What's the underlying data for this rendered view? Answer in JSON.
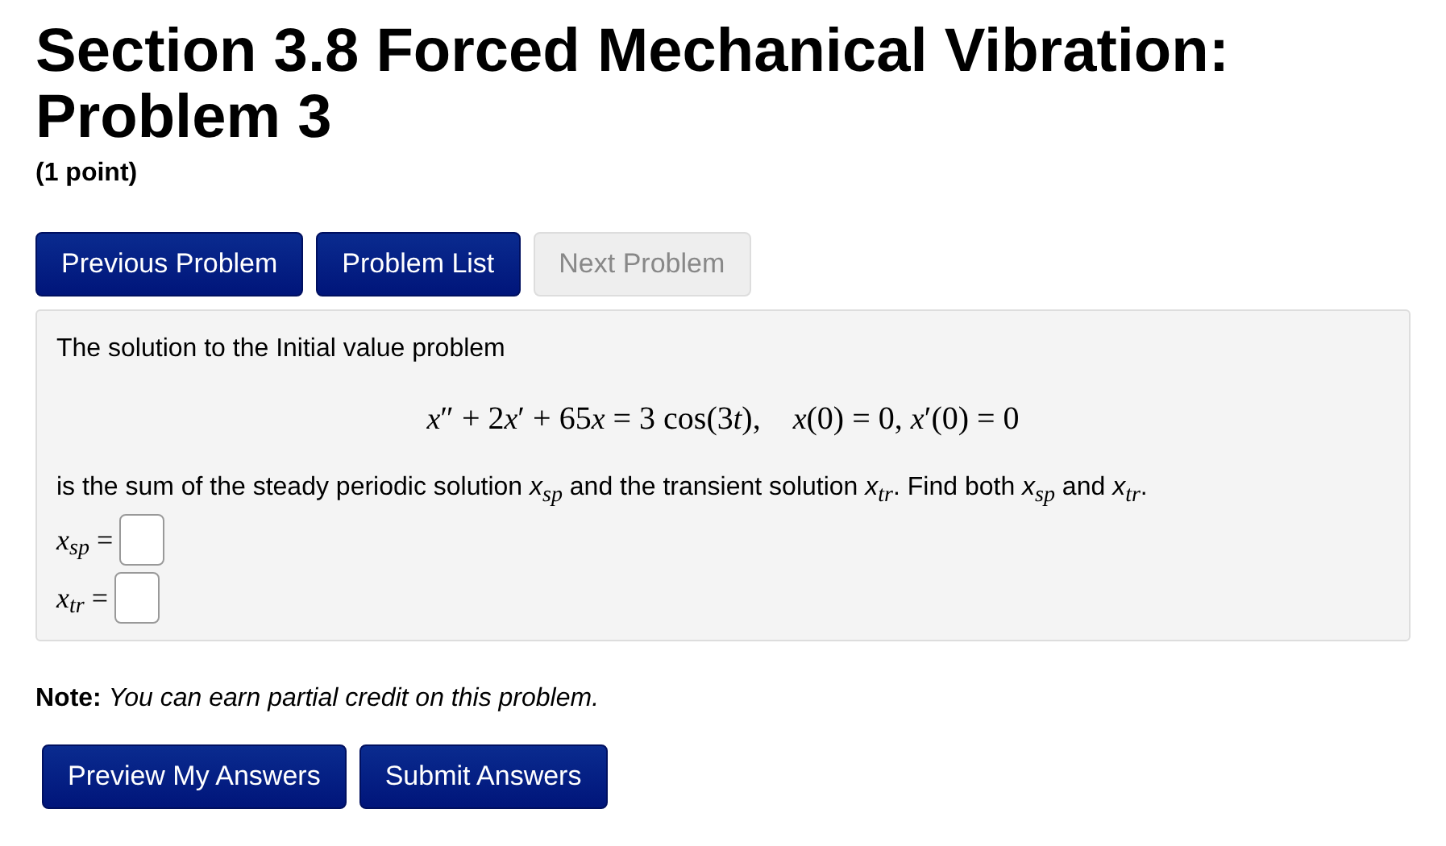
{
  "title": "Section 3.8 Forced Mechanical Vibration: Problem 3",
  "points": "(1 point)",
  "nav_buttons": [
    {
      "label": "Previous Problem",
      "disabled": false
    },
    {
      "label": "Problem List",
      "disabled": false
    },
    {
      "label": "Next Problem",
      "disabled": true
    }
  ],
  "problem": {
    "intro": "The solution to the Initial value problem",
    "equation": [
      {
        "text": "x",
        "italic": true
      },
      {
        "text": "″ + 2",
        "italic": false
      },
      {
        "text": "x",
        "italic": true
      },
      {
        "text": "′ + 65",
        "italic": false
      },
      {
        "text": "x",
        "italic": true
      },
      {
        "text": " = 3 cos(3",
        "italic": false
      },
      {
        "text": "t",
        "italic": true
      },
      {
        "text": "),    ",
        "italic": false
      },
      {
        "text": "x",
        "italic": true
      },
      {
        "text": "(0) = 0, ",
        "italic": false
      },
      {
        "text": "x",
        "italic": true
      },
      {
        "text": "′(0) = 0",
        "italic": false
      }
    ],
    "statement": "is the sum of the steady periodic solution *x*$_{sp}$ and the transient solution *x*$_{tr}$. Find both *x*$_{sp}$ and *x*$_{tr}$.",
    "answers": [
      {
        "label": "*x*$_{sp}$ ="
      },
      {
        "label": "*x*$_{tr}$ ="
      }
    ]
  },
  "note": {
    "label": "Note:",
    "text": "You can earn partial credit on this problem."
  },
  "submit_buttons": [
    "Preview My Answers",
    "Submit Answers"
  ]
}
